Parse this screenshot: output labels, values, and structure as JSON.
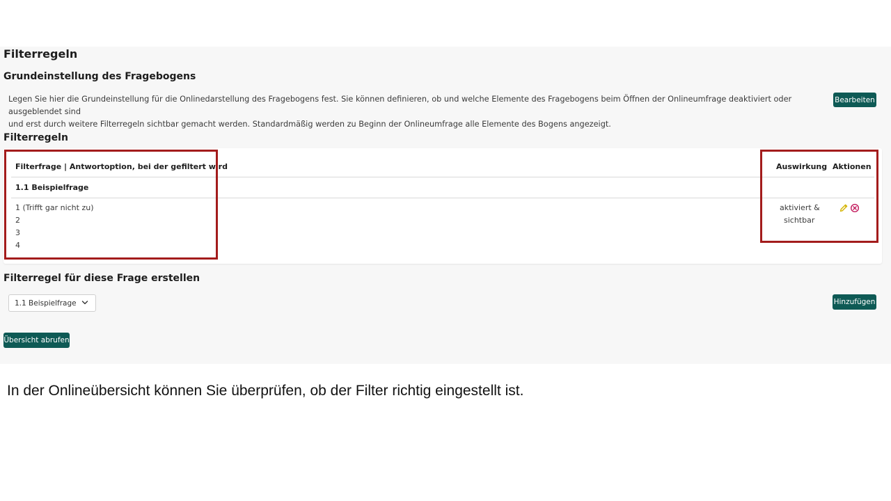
{
  "page": {
    "title": "Filterregeln",
    "settings": {
      "heading": "Grundeinstellung des Fragebogens",
      "description_line1": "Legen Sie hier die Grundeinstellung für die Onlinedarstellung des Fragebogens fest. Sie können definieren, ob und welche Elemente des Fragebogens beim Öffnen der Onlineumfrage deaktiviert oder ausgeblendet sind",
      "description_line2": "und erst durch weitere Filterregeln sichtbar gemacht werden. Standardmäßig werden zu Beginn der Onlineumfrage alle Elemente des Bogens angezeigt.",
      "edit_button": "Bearbeiten"
    },
    "rules": {
      "heading": "Filterregeln",
      "columns": {
        "question": "Filterfrage | Antwortoption, bei der gefiltert wird",
        "effect": "Auswirkung",
        "actions": "Aktionen"
      },
      "group": "1.1 Beispielfrage",
      "options": [
        "1 (Trifft gar nicht zu)",
        "2",
        "3",
        "4"
      ],
      "effect_line1": "aktiviert &",
      "effect_line2": "sichtbar",
      "actions_icons": [
        "edit-pencil-icon",
        "delete-circle-x-icon"
      ]
    },
    "create": {
      "heading": "Filterregel für diese Frage erstellen",
      "selected_question": "1.1 Beispielfrage",
      "add_button": "Hinzufügen"
    },
    "overview_button": "Übersicht abrufen"
  },
  "caption": "In der Onlineübersicht können Sie überprüfen, ob der Filter richtig eingestellt ist.",
  "colors": {
    "accent": "#0e5a55",
    "highlight": "#a31c1c",
    "edit_icon": "#d4b300",
    "delete_icon": "#c2185b"
  }
}
